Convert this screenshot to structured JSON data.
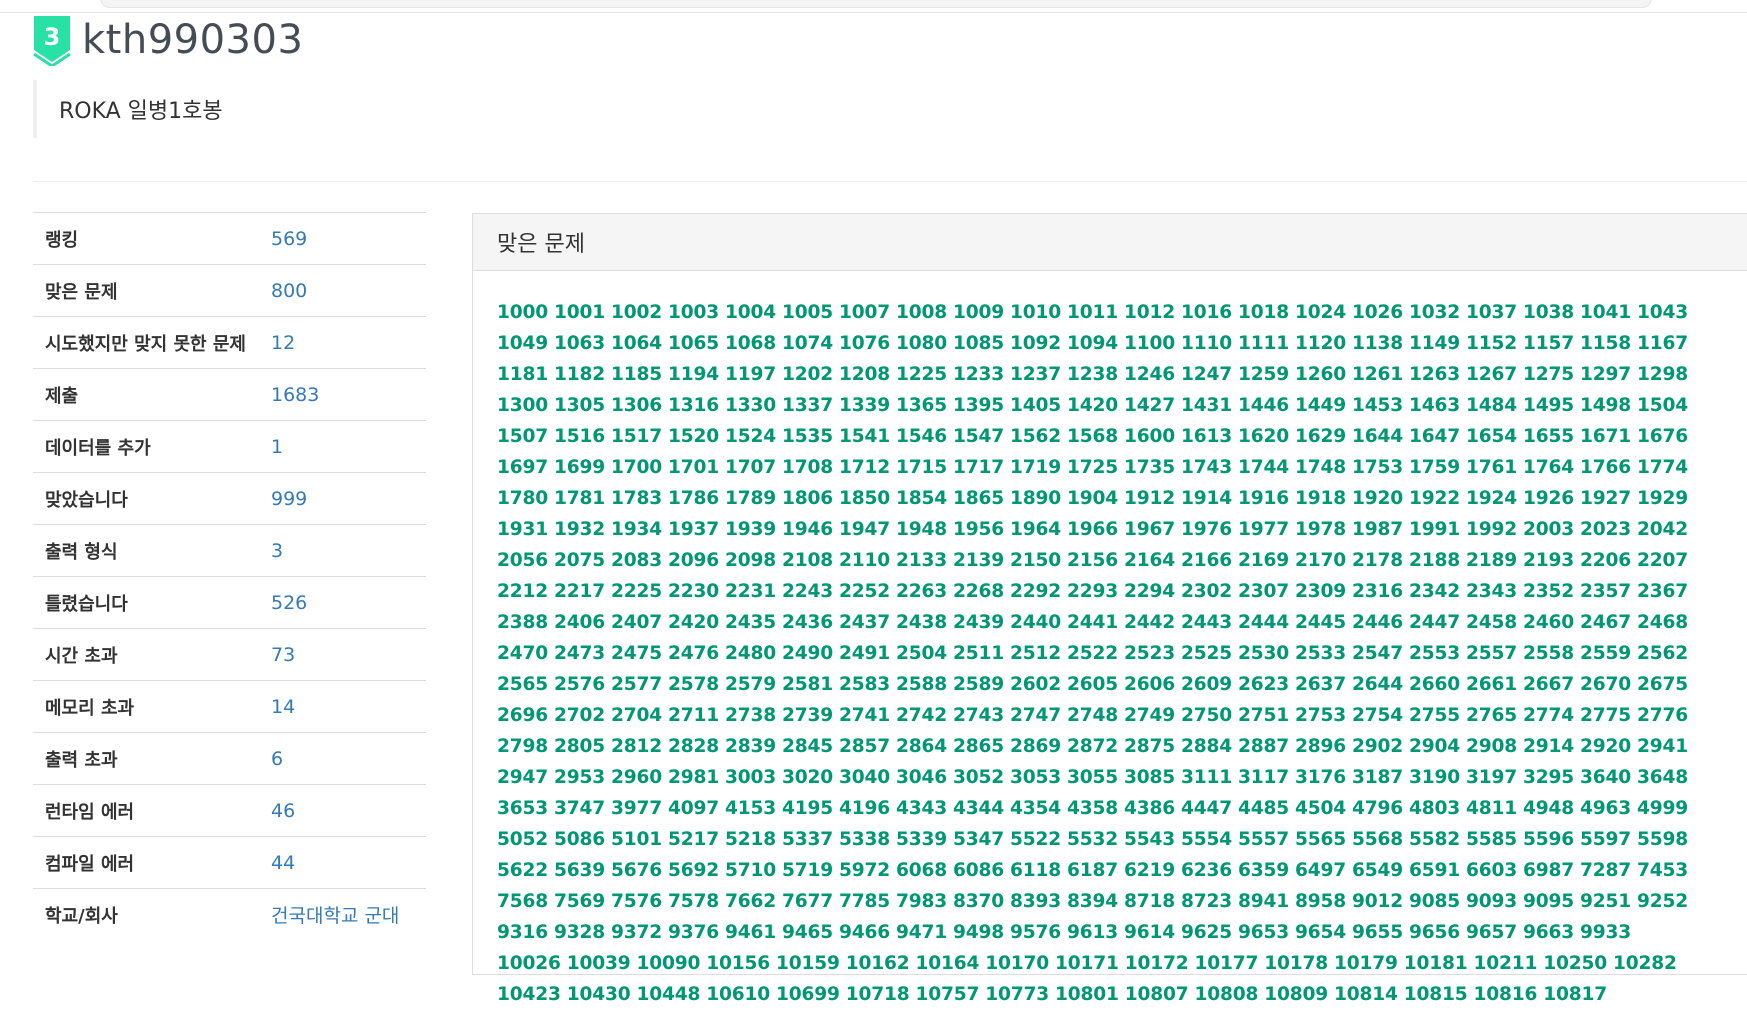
{
  "profile": {
    "tier_badge_text": "3",
    "username": "kth990303",
    "status_message": "ROKA 일병1호봉"
  },
  "stats": [
    {
      "label": "랭킹",
      "value": "569"
    },
    {
      "label": "맞은 문제",
      "value": "800"
    },
    {
      "label": "시도했지만 맞지 못한 문제",
      "value": "12"
    },
    {
      "label": "제출",
      "value": "1683"
    },
    {
      "label": "데이터를 추가",
      "value": "1"
    },
    {
      "label": "맞았습니다",
      "value": "999"
    },
    {
      "label": "출력 형식",
      "value": "3"
    },
    {
      "label": "틀렸습니다",
      "value": "526"
    },
    {
      "label": "시간 초과",
      "value": "73"
    },
    {
      "label": "메모리 초과",
      "value": "14"
    },
    {
      "label": "출력 초과",
      "value": "6"
    },
    {
      "label": "런타임 에러",
      "value": "46"
    },
    {
      "label": "컴파일 에러",
      "value": "44"
    },
    {
      "label": "학교/회사",
      "value": "건국대학교 군대"
    }
  ],
  "solved_panel": {
    "title": "맞은 문제",
    "problems": [
      "1000",
      "1001",
      "1002",
      "1003",
      "1004",
      "1005",
      "1007",
      "1008",
      "1009",
      "1010",
      "1011",
      "1012",
      "1016",
      "1018",
      "1024",
      "1026",
      "1032",
      "1037",
      "1038",
      "1041",
      "1043",
      "1049",
      "1063",
      "1064",
      "1065",
      "1068",
      "1074",
      "1076",
      "1080",
      "1085",
      "1092",
      "1094",
      "1100",
      "1110",
      "1111",
      "1120",
      "1138",
      "1149",
      "1152",
      "1157",
      "1158",
      "1167",
      "1181",
      "1182",
      "1185",
      "1194",
      "1197",
      "1202",
      "1208",
      "1225",
      "1233",
      "1237",
      "1238",
      "1246",
      "1247",
      "1259",
      "1260",
      "1261",
      "1263",
      "1267",
      "1275",
      "1297",
      "1298",
      "1300",
      "1305",
      "1306",
      "1316",
      "1330",
      "1337",
      "1339",
      "1365",
      "1395",
      "1405",
      "1420",
      "1427",
      "1431",
      "1446",
      "1449",
      "1453",
      "1463",
      "1484",
      "1495",
      "1498",
      "1504",
      "1507",
      "1516",
      "1517",
      "1520",
      "1524",
      "1535",
      "1541",
      "1546",
      "1547",
      "1562",
      "1568",
      "1600",
      "1613",
      "1620",
      "1629",
      "1644",
      "1647",
      "1654",
      "1655",
      "1671",
      "1676",
      "1697",
      "1699",
      "1700",
      "1701",
      "1707",
      "1708",
      "1712",
      "1715",
      "1717",
      "1719",
      "1725",
      "1735",
      "1743",
      "1744",
      "1748",
      "1753",
      "1759",
      "1761",
      "1764",
      "1766",
      "1774",
      "1780",
      "1781",
      "1783",
      "1786",
      "1789",
      "1806",
      "1850",
      "1854",
      "1865",
      "1890",
      "1904",
      "1912",
      "1914",
      "1916",
      "1918",
      "1920",
      "1922",
      "1924",
      "1926",
      "1927",
      "1929",
      "1931",
      "1932",
      "1934",
      "1937",
      "1939",
      "1946",
      "1947",
      "1948",
      "1956",
      "1964",
      "1966",
      "1967",
      "1976",
      "1977",
      "1978",
      "1987",
      "1991",
      "1992",
      "2003",
      "2023",
      "2042",
      "2056",
      "2075",
      "2083",
      "2096",
      "2098",
      "2108",
      "2110",
      "2133",
      "2139",
      "2150",
      "2156",
      "2164",
      "2166",
      "2169",
      "2170",
      "2178",
      "2188",
      "2189",
      "2193",
      "2206",
      "2207",
      "2212",
      "2217",
      "2225",
      "2230",
      "2231",
      "2243",
      "2252",
      "2263",
      "2268",
      "2292",
      "2293",
      "2294",
      "2302",
      "2307",
      "2309",
      "2316",
      "2342",
      "2343",
      "2352",
      "2357",
      "2367",
      "2388",
      "2406",
      "2407",
      "2420",
      "2435",
      "2436",
      "2437",
      "2438",
      "2439",
      "2440",
      "2441",
      "2442",
      "2443",
      "2444",
      "2445",
      "2446",
      "2447",
      "2458",
      "2460",
      "2467",
      "2468",
      "2470",
      "2473",
      "2475",
      "2476",
      "2480",
      "2490",
      "2491",
      "2504",
      "2511",
      "2512",
      "2522",
      "2523",
      "2525",
      "2530",
      "2533",
      "2547",
      "2553",
      "2557",
      "2558",
      "2559",
      "2562",
      "2565",
      "2576",
      "2577",
      "2578",
      "2579",
      "2581",
      "2583",
      "2588",
      "2589",
      "2602",
      "2605",
      "2606",
      "2609",
      "2623",
      "2637",
      "2644",
      "2660",
      "2661",
      "2667",
      "2670",
      "2675",
      "2696",
      "2702",
      "2704",
      "2711",
      "2738",
      "2739",
      "2741",
      "2742",
      "2743",
      "2747",
      "2748",
      "2749",
      "2750",
      "2751",
      "2753",
      "2754",
      "2755",
      "2765",
      "2774",
      "2775",
      "2776",
      "2798",
      "2805",
      "2812",
      "2828",
      "2839",
      "2845",
      "2857",
      "2864",
      "2865",
      "2869",
      "2872",
      "2875",
      "2884",
      "2887",
      "2896",
      "2902",
      "2904",
      "2908",
      "2914",
      "2920",
      "2941",
      "2947",
      "2953",
      "2960",
      "2981",
      "3003",
      "3020",
      "3040",
      "3046",
      "3052",
      "3053",
      "3055",
      "3085",
      "3111",
      "3117",
      "3176",
      "3187",
      "3190",
      "3197",
      "3295",
      "3640",
      "3648",
      "3653",
      "3747",
      "3977",
      "4097",
      "4153",
      "4195",
      "4196",
      "4343",
      "4344",
      "4354",
      "4358",
      "4386",
      "4447",
      "4485",
      "4504",
      "4796",
      "4803",
      "4811",
      "4948",
      "4963",
      "4999",
      "5052",
      "5086",
      "5101",
      "5217",
      "5218",
      "5337",
      "5338",
      "5339",
      "5347",
      "5522",
      "5532",
      "5543",
      "5554",
      "5557",
      "5565",
      "5568",
      "5582",
      "5585",
      "5596",
      "5597",
      "5598",
      "5622",
      "5639",
      "5676",
      "5692",
      "5710",
      "5719",
      "5972",
      "6068",
      "6086",
      "6118",
      "6187",
      "6219",
      "6236",
      "6359",
      "6497",
      "6549",
      "6591",
      "6603",
      "6987",
      "7287",
      "7453",
      "7568",
      "7569",
      "7576",
      "7578",
      "7662",
      "7677",
      "7785",
      "7983",
      "8370",
      "8393",
      "8394",
      "8718",
      "8723",
      "8941",
      "8958",
      "9012",
      "9085",
      "9093",
      "9095",
      "9251",
      "9252",
      "9316",
      "9328",
      "9372",
      "9376",
      "9461",
      "9465",
      "9466",
      "9471",
      "9498",
      "9576",
      "9613",
      "9614",
      "9625",
      "9653",
      "9654",
      "9655",
      "9656",
      "9657",
      "9663",
      "9933",
      "10026",
      "10039",
      "10090",
      "10156",
      "10159",
      "10162",
      "10164",
      "10170",
      "10171",
      "10172",
      "10177",
      "10178",
      "10179",
      "10181",
      "10211",
      "10250",
      "10282",
      "10423",
      "10430",
      "10448",
      "10610",
      "10699",
      "10718",
      "10757",
      "10773",
      "10801",
      "10807",
      "10808",
      "10809",
      "10814",
      "10815",
      "10816",
      "10817"
    ]
  },
  "colors": {
    "link_blue": "#337ab7",
    "solved_green": "#009874",
    "tier_badge": "#27e2a4"
  }
}
